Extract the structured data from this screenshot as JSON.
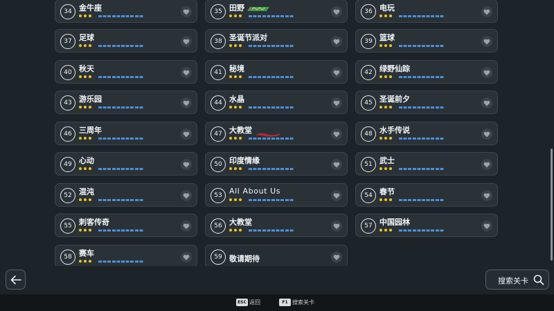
{
  "levels": [
    {
      "num": "34",
      "title": "金牛座"
    },
    {
      "num": "35",
      "title": "田野"
    },
    {
      "num": "36",
      "title": "电玩"
    },
    {
      "num": "37",
      "title": "足球"
    },
    {
      "num": "38",
      "title": "圣诞节派对"
    },
    {
      "num": "39",
      "title": "篮球"
    },
    {
      "num": "40",
      "title": "秋天"
    },
    {
      "num": "41",
      "title": "秘境"
    },
    {
      "num": "42",
      "title": "绿野仙踪"
    },
    {
      "num": "43",
      "title": "游乐园"
    },
    {
      "num": "44",
      "title": "水晶"
    },
    {
      "num": "45",
      "title": "圣诞前夕"
    },
    {
      "num": "46",
      "title": "三周年"
    },
    {
      "num": "47",
      "title": "大教堂"
    },
    {
      "num": "48",
      "title": "水手传说"
    },
    {
      "num": "49",
      "title": "心动"
    },
    {
      "num": "50",
      "title": "印度情缘"
    },
    {
      "num": "51",
      "title": "武士"
    },
    {
      "num": "52",
      "title": "混沌"
    },
    {
      "num": "53",
      "title": "All About Us"
    },
    {
      "num": "54",
      "title": "春节"
    },
    {
      "num": "55",
      "title": "刺客传奇"
    },
    {
      "num": "56",
      "title": "大教堂"
    },
    {
      "num": "57",
      "title": "中国园林"
    },
    {
      "num": "58",
      "title": "赛车"
    },
    {
      "num": "59",
      "title": "敬请期待",
      "locked": true
    }
  ],
  "colors": {
    "star": "#f2c21b",
    "progress": "#4d8fd8",
    "card_bg": "#2a3238",
    "page_bg": "#1c2329"
  },
  "toolbar": {
    "search_label": "搜索关卡",
    "back_icon": "arrow-left-icon",
    "search_icon": "search-icon"
  },
  "footer": {
    "esc_key": "ESC",
    "esc_label": "返回",
    "f1_key": "F1",
    "f1_label": "搜索关卡"
  }
}
